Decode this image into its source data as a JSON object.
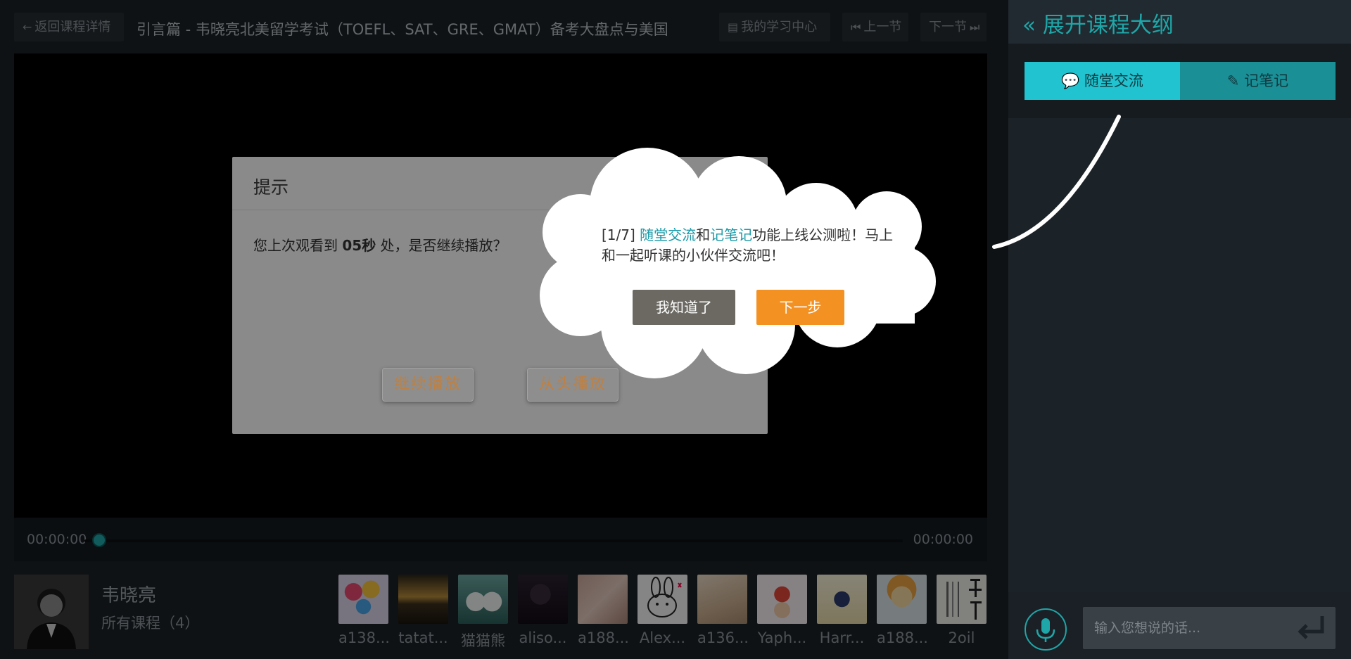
{
  "header": {
    "back_label": "返回课程详情",
    "course_title": "引言篇 - 韦晓亮北美留学考试（TOEFL、SAT、GRE、GMAT）备考大盘点与美国",
    "study_center_label": "我的学习中心",
    "prev_label": "上一节",
    "next_label": "下一节"
  },
  "player": {
    "current_time": "00:00:00",
    "total_time": "00:00:00",
    "progress": 0
  },
  "teacher": {
    "name": "韦晓亮",
    "courses_label": "所有课程（4）"
  },
  "students": [
    {
      "name": "a138..."
    },
    {
      "name": "tatat..."
    },
    {
      "name": "猫猫熊"
    },
    {
      "name": "aliso..."
    },
    {
      "name": "a188..."
    },
    {
      "name": "Alex..."
    },
    {
      "name": "a136..."
    },
    {
      "name": "Yaph..."
    },
    {
      "name": "Harr..."
    },
    {
      "name": "a188..."
    },
    {
      "name": "2oil"
    }
  ],
  "dialog": {
    "title": "提示",
    "msg_prefix": "您上次观看到 ",
    "msg_time": "05秒",
    "msg_suffix": " 处，是否继续播放？",
    "continue_label": "继续播放",
    "restart_label": "从头播放"
  },
  "tip": {
    "step": "[1/7]",
    "highlight1": "随堂交流",
    "mid": "和",
    "highlight2": "记笔记",
    "rest": "功能上线公测啦！马上和一起听课的小伙伴交流吧！",
    "got_it_label": "我知道了",
    "next_step_label": "下一步"
  },
  "sidebar": {
    "outline_label": "展开课程大纲",
    "tab_chat": "随堂交流",
    "tab_note": "记笔记",
    "input_placeholder": "输入您想说的话..."
  },
  "colors": {
    "accent": "#1fa6a8",
    "tab_active": "#20c3cf",
    "orange": "#f39123"
  }
}
